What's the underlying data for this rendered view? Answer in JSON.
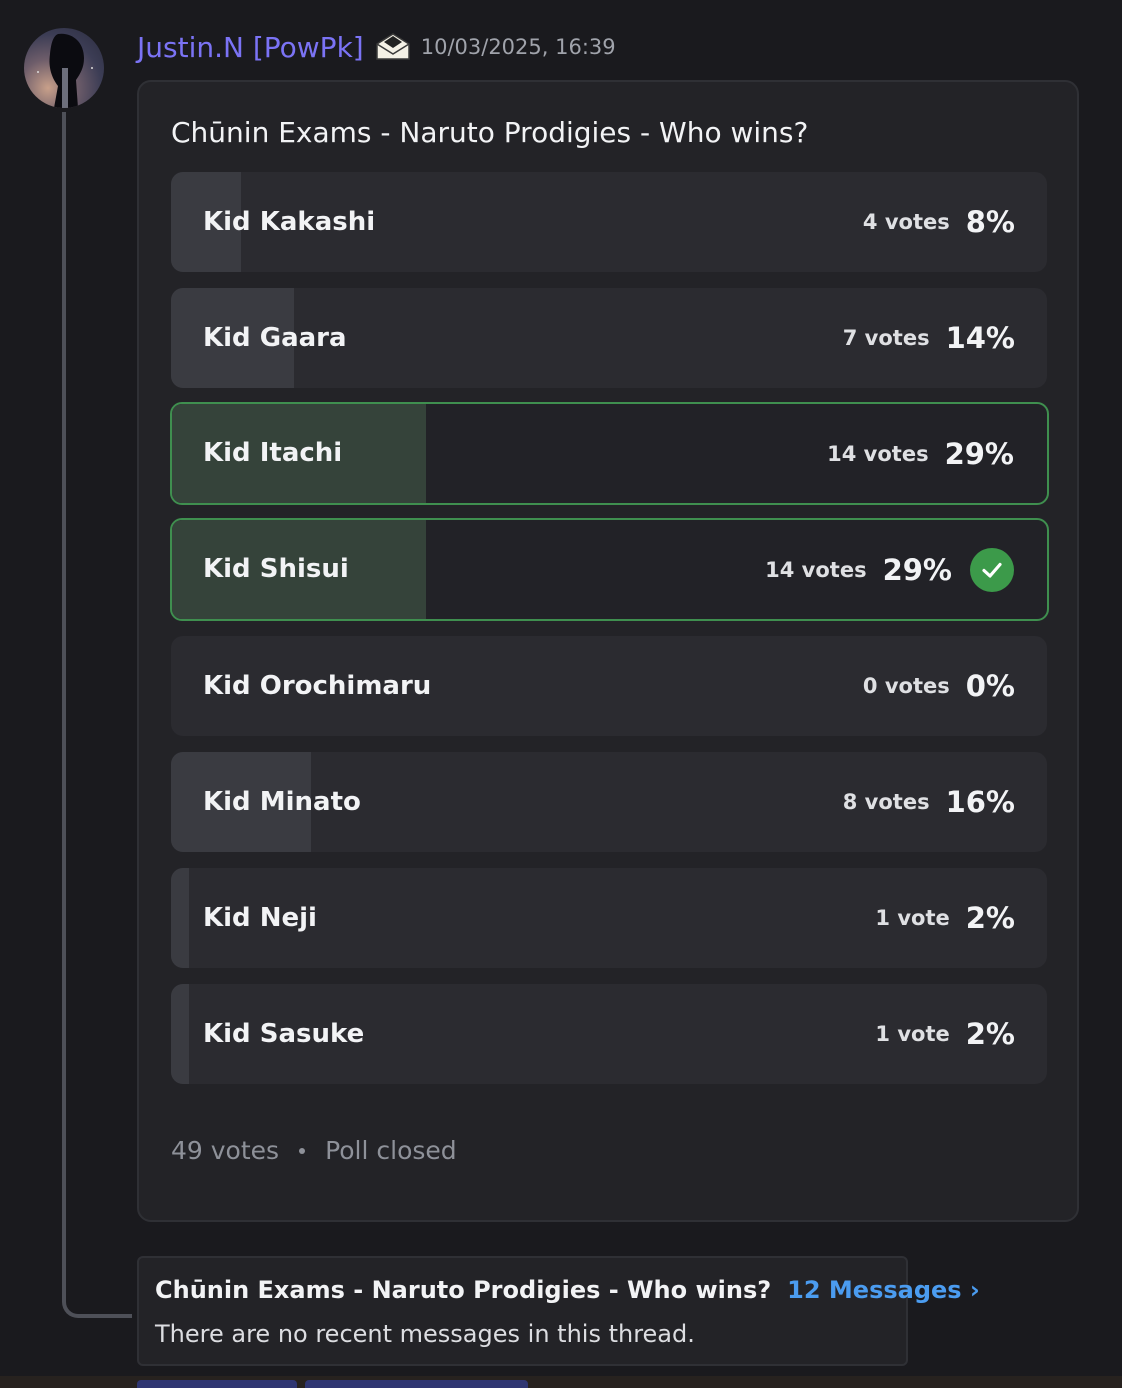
{
  "message": {
    "username": "Justin.N [PowPk]",
    "badge_icon": "envelope-badge-icon",
    "timestamp": "10/03/2025, 16:39"
  },
  "poll": {
    "question": "Chūnin Exams - Naruto Prodigies - Who wins?",
    "options": [
      {
        "label": "Kid Kakashi",
        "votes": "4 votes",
        "percent": "8%",
        "fraction": 0.08,
        "winner": false
      },
      {
        "label": "Kid Gaara",
        "votes": "7 votes",
        "percent": "14%",
        "fraction": 0.14,
        "winner": false
      },
      {
        "label": "Kid Itachi",
        "votes": "14 votes",
        "percent": "29%",
        "fraction": 0.29,
        "winner": true
      },
      {
        "label": "Kid Shisui",
        "votes": "14 votes",
        "percent": "29%",
        "fraction": 0.29,
        "winner": true,
        "voted": true
      },
      {
        "label": "Kid Orochimaru",
        "votes": "0 votes",
        "percent": "0%",
        "fraction": 0.0,
        "winner": false
      },
      {
        "label": "Kid Minato",
        "votes": "8 votes",
        "percent": "16%",
        "fraction": 0.16,
        "winner": false
      },
      {
        "label": "Kid Neji",
        "votes": "1 vote",
        "percent": "2%",
        "fraction": 0.02,
        "winner": false
      },
      {
        "label": "Kid Sasuke",
        "votes": "1 vote",
        "percent": "2%",
        "fraction": 0.02,
        "winner": false
      }
    ],
    "total_votes": "49 votes",
    "status": "Poll closed"
  },
  "thread": {
    "title": "Chūnin Exams - Naruto Prodigies - Who wins?",
    "link_label": "12 Messages ›",
    "subtitle": "There are no recent messages in this thread."
  },
  "colors": {
    "username": "#7b73f5",
    "winner_border": "#3f8f4f",
    "check": "#3c9a4a",
    "link": "#4b9cf0"
  }
}
